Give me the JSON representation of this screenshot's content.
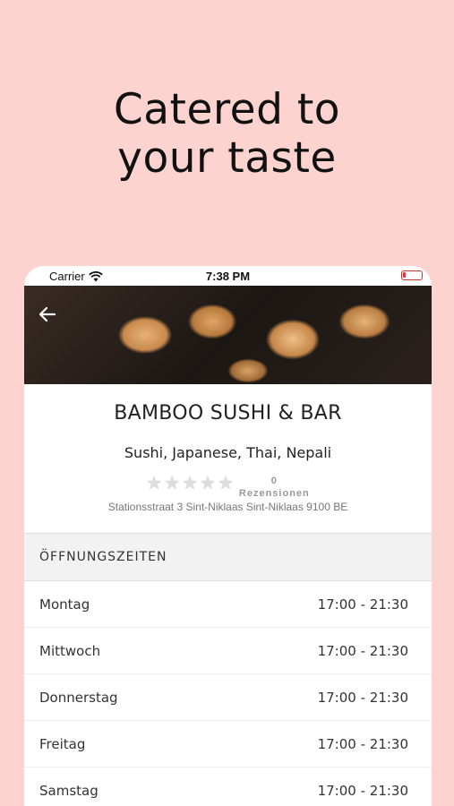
{
  "headline": {
    "line1": "Catered to",
    "line2": "your taste"
  },
  "statusbar": {
    "carrier": "Carrier",
    "time": "7:38 PM"
  },
  "restaurant": {
    "name": "BAMBOO SUSHI & BAR",
    "cuisines": "Sushi, Japanese, Thai, Nepali",
    "rating": 0,
    "review_count": "0",
    "review_label": "Rezensionen",
    "address": "Stationsstraat 3 Sint-Niklaas Sint-Niklaas 9100 BE"
  },
  "hours": {
    "title": "ÖFFNUNGSZEITEN",
    "rows": [
      {
        "day": "Montag",
        "time": "17:00 - 21:30"
      },
      {
        "day": "Mittwoch",
        "time": "17:00 - 21:30"
      },
      {
        "day": "Donnerstag",
        "time": "17:00 - 21:30"
      },
      {
        "day": "Freitag",
        "time": "17:00 - 21:30"
      },
      {
        "day": "Samstag",
        "time": "17:00 - 21:30"
      }
    ]
  },
  "colors": {
    "background": "#fdd3cf",
    "battery": "#e33"
  }
}
